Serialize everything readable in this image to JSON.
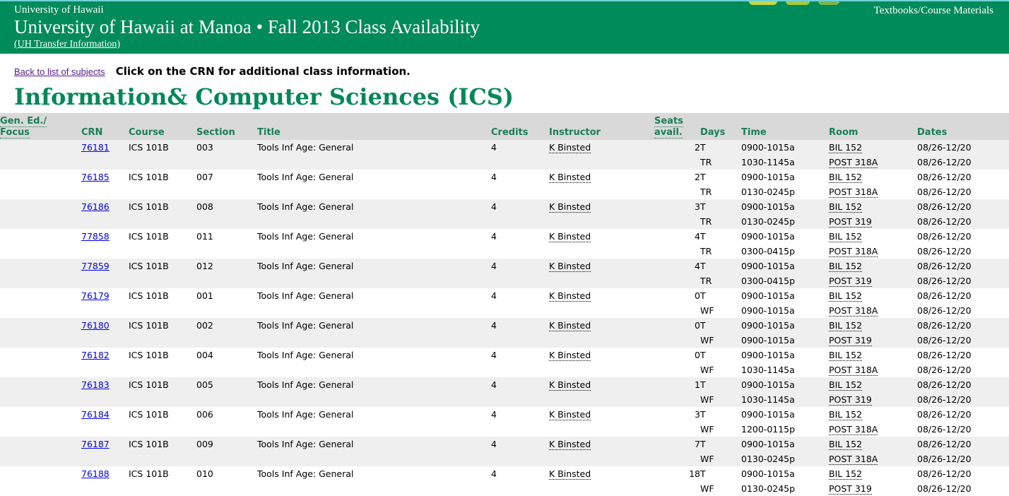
{
  "header": {
    "university": "University of Hawaii",
    "title": "University of Hawaii at Manoa • Fall 2013 Class Availability",
    "transfer_link": "(UH Transfer Information)",
    "textbooks_link": "Textbooks/Course Materials"
  },
  "nav": {
    "back_link": "Back to list of subjects",
    "instruction": "Click on the CRN for additional class information."
  },
  "subject": "Information& Computer Sciences (ICS)",
  "table": {
    "headers": {
      "gen_ed_1": "Gen. Ed./",
      "gen_ed_2": "Focus",
      "crn": "CRN",
      "course": "Course",
      "section": "Section",
      "title": "Title",
      "credits": "Credits",
      "instructor": "Instructor",
      "seats_1": "Seats",
      "seats_2": "avail.",
      "days": "Days",
      "time": "Time",
      "room": "Room",
      "dates": "Dates"
    },
    "rows": [
      {
        "crn": "76181",
        "course": "ICS 101B",
        "section": "003",
        "title": "Tools Inf Age: General",
        "credits": "4",
        "instructor": "K Binsted",
        "seats": "2",
        "meetings": [
          {
            "days": "T",
            "time": "0900-1015a",
            "room": "BIL 152",
            "dates": "08/26-12/20"
          },
          {
            "days": "TR",
            "time": "1030-1145a",
            "room": "POST 318A",
            "dates": "08/26-12/20"
          }
        ]
      },
      {
        "crn": "76185",
        "course": "ICS 101B",
        "section": "007",
        "title": "Tools Inf Age: General",
        "credits": "4",
        "instructor": "K Binsted",
        "seats": "2",
        "meetings": [
          {
            "days": "T",
            "time": "0900-1015a",
            "room": "BIL 152",
            "dates": "08/26-12/20"
          },
          {
            "days": "TR",
            "time": "0130-0245p",
            "room": "POST 318A",
            "dates": "08/26-12/20"
          }
        ]
      },
      {
        "crn": "76186",
        "course": "ICS 101B",
        "section": "008",
        "title": "Tools Inf Age: General",
        "credits": "4",
        "instructor": "K Binsted",
        "seats": "3",
        "meetings": [
          {
            "days": "T",
            "time": "0900-1015a",
            "room": "BIL 152",
            "dates": "08/26-12/20"
          },
          {
            "days": "TR",
            "time": "0130-0245p",
            "room": "POST 319",
            "dates": "08/26-12/20"
          }
        ]
      },
      {
        "crn": "77858",
        "course": "ICS 101B",
        "section": "011",
        "title": "Tools Inf Age: General",
        "credits": "4",
        "instructor": "K Binsted",
        "seats": "4",
        "meetings": [
          {
            "days": "T",
            "time": "0900-1015a",
            "room": "BIL 152",
            "dates": "08/26-12/20"
          },
          {
            "days": "TR",
            "time": "0300-0415p",
            "room": "POST 318A",
            "dates": "08/26-12/20"
          }
        ]
      },
      {
        "crn": "77859",
        "course": "ICS 101B",
        "section": "012",
        "title": "Tools Inf Age: General",
        "credits": "4",
        "instructor": "K Binsted",
        "seats": "4",
        "meetings": [
          {
            "days": "T",
            "time": "0900-1015a",
            "room": "BIL 152",
            "dates": "08/26-12/20"
          },
          {
            "days": "TR",
            "time": "0300-0415p",
            "room": "POST 319",
            "dates": "08/26-12/20"
          }
        ]
      },
      {
        "crn": "76179",
        "course": "ICS 101B",
        "section": "001",
        "title": "Tools Inf Age: General",
        "credits": "4",
        "instructor": "K Binsted",
        "seats": "0",
        "meetings": [
          {
            "days": "T",
            "time": "0900-1015a",
            "room": "BIL 152",
            "dates": "08/26-12/20"
          },
          {
            "days": "WF",
            "time": "0900-1015a",
            "room": "POST 318A",
            "dates": "08/26-12/20"
          }
        ]
      },
      {
        "crn": "76180",
        "course": "ICS 101B",
        "section": "002",
        "title": "Tools Inf Age: General",
        "credits": "4",
        "instructor": "K Binsted",
        "seats": "0",
        "meetings": [
          {
            "days": "T",
            "time": "0900-1015a",
            "room": "BIL 152",
            "dates": "08/26-12/20"
          },
          {
            "days": "WF",
            "time": "0900-1015a",
            "room": "POST 319",
            "dates": "08/26-12/20"
          }
        ]
      },
      {
        "crn": "76182",
        "course": "ICS 101B",
        "section": "004",
        "title": "Tools Inf Age: General",
        "credits": "4",
        "instructor": "K Binsted",
        "seats": "0",
        "meetings": [
          {
            "days": "T",
            "time": "0900-1015a",
            "room": "BIL 152",
            "dates": "08/26-12/20"
          },
          {
            "days": "WF",
            "time": "1030-1145a",
            "room": "POST 318A",
            "dates": "08/26-12/20"
          }
        ]
      },
      {
        "crn": "76183",
        "course": "ICS 101B",
        "section": "005",
        "title": "Tools Inf Age: General",
        "credits": "4",
        "instructor": "K Binsted",
        "seats": "1",
        "meetings": [
          {
            "days": "T",
            "time": "0900-1015a",
            "room": "BIL 152",
            "dates": "08/26-12/20"
          },
          {
            "days": "WF",
            "time": "1030-1145a",
            "room": "POST 319",
            "dates": "08/26-12/20"
          }
        ]
      },
      {
        "crn": "76184",
        "course": "ICS 101B",
        "section": "006",
        "title": "Tools Inf Age: General",
        "credits": "4",
        "instructor": "K Binsted",
        "seats": "3",
        "meetings": [
          {
            "days": "T",
            "time": "0900-1015a",
            "room": "BIL 152",
            "dates": "08/26-12/20"
          },
          {
            "days": "WF",
            "time": "1200-0115p",
            "room": "POST 318A",
            "dates": "08/26-12/20"
          }
        ]
      },
      {
        "crn": "76187",
        "course": "ICS 101B",
        "section": "009",
        "title": "Tools Inf Age: General",
        "credits": "4",
        "instructor": "K Binsted",
        "seats": "7",
        "meetings": [
          {
            "days": "T",
            "time": "0900-1015a",
            "room": "BIL 152",
            "dates": "08/26-12/20"
          },
          {
            "days": "WF",
            "time": "0130-0245p",
            "room": "POST 318A",
            "dates": "08/26-12/20"
          }
        ]
      },
      {
        "crn": "76188",
        "course": "ICS 101B",
        "section": "010",
        "title": "Tools Inf Age: General",
        "credits": "4",
        "instructor": "K Binsted",
        "seats": "18",
        "meetings": [
          {
            "days": "T",
            "time": "0900-1015a",
            "room": "BIL 152",
            "dates": "08/26-12/20"
          },
          {
            "days": "WF",
            "time": "0130-0245p",
            "room": "POST 319",
            "dates": "08/26-12/20"
          }
        ]
      }
    ]
  },
  "colors": {
    "header_bg": "#008b5a",
    "title_green": "#00875a",
    "header_row_bg": "#d9d9d9",
    "stripe_bg": "#efefef",
    "crn_link": "#0000ee"
  }
}
